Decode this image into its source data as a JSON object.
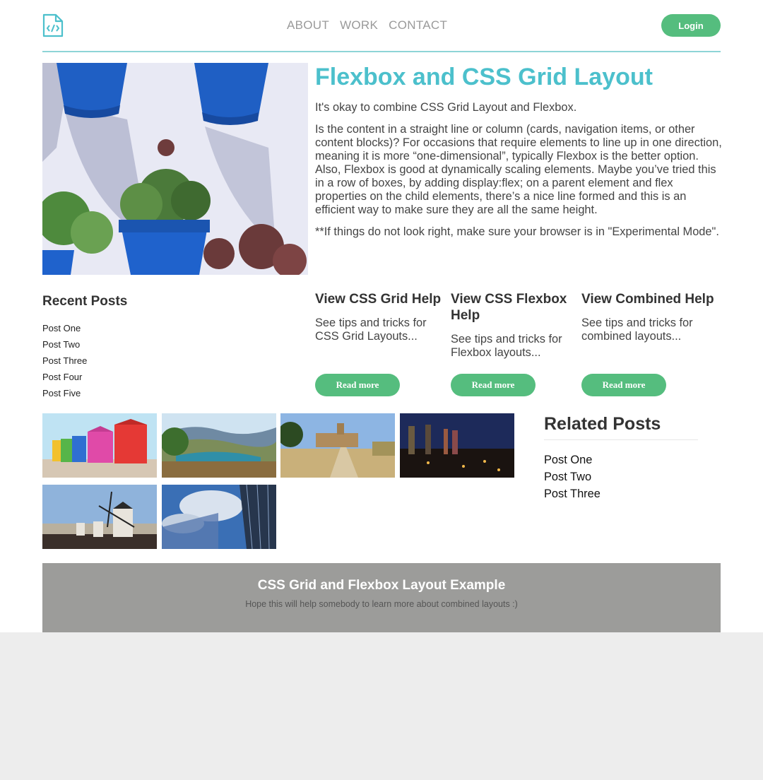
{
  "header": {
    "logo_icon": "code-file-icon",
    "nav": [
      "ABOUT",
      "WORK",
      "CONTACT"
    ],
    "login_label": "Login"
  },
  "hero": {
    "title": "Flexbox and CSS Grid Layout",
    "paragraphs": [
      "It's okay to combine CSS Grid Layout and Flexbox.",
      "Is the content in a straight line or column (cards, navigation items, or other content blocks)? For occasions that require elements to line up in one direction, meaning it is more “one-dimensional”, typically Flexbox is the better option. Also, Flexbox is good at dynamically scaling elements. Maybe you’ve tried this in a row of boxes, by adding display:flex; on a parent element and flex properties on the child elements, there’s a nice line formed and this is an efficient way to make sure they are all the same height.",
      "**If things do not look right, make sure your browser is in \"Experimental Mode\"."
    ]
  },
  "recent_posts": {
    "title": "Recent Posts",
    "items": [
      "Post One",
      "Post Two",
      "Post Three",
      "Post Four",
      "Post Five"
    ]
  },
  "cards": [
    {
      "title": "View CSS Grid Help",
      "text": "See tips and tricks for CSS Grid Layouts...",
      "button": "Read more"
    },
    {
      "title": "View CSS Flexbox Help",
      "text": "See tips and tricks for Flexbox layouts...",
      "button": "Read more"
    },
    {
      "title": "View Combined Help",
      "text": "See tips and tricks for combined layouts...",
      "button": "Read more"
    }
  ],
  "related_posts": {
    "title": "Related Posts",
    "items": [
      "Post One",
      "Post Two",
      "Post Three"
    ]
  },
  "footer": {
    "title": "CSS Grid and Flexbox Layout Example",
    "subtitle": "Hope this will help somebody to learn more about combined layouts :)"
  },
  "colors": {
    "accent_teal": "#4cc0cc",
    "button_green": "#55bd7e",
    "footer_gray": "#9c9c9a"
  }
}
